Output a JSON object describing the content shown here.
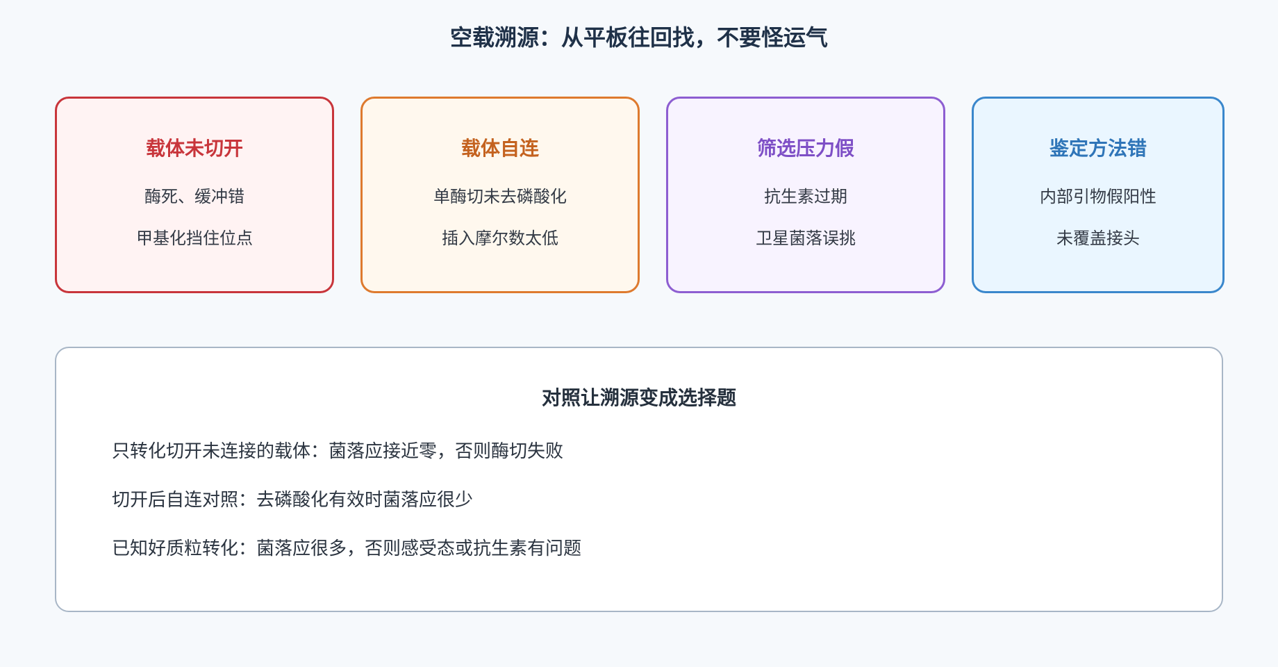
{
  "title": "空载溯源：从平板往回找，不要怪运气",
  "cards": [
    {
      "title": "载体未切开",
      "items": [
        "酶死、缓冲错",
        "甲基化挡住位点"
      ],
      "title_color": "#c8353b"
    },
    {
      "title": "载体自连",
      "items": [
        "单酶切未去磷酸化",
        "插入摩尔数太低"
      ],
      "title_color": "#c4621f"
    },
    {
      "title": "筛选压力假",
      "items": [
        "抗生素过期",
        "卫星菌落误挑"
      ],
      "title_color": "#7e4fc6"
    },
    {
      "title": "鉴定方法错",
      "items": [
        "内部引物假阳性",
        "未覆盖接头"
      ],
      "title_color": "#2f75b8"
    }
  ],
  "panel": {
    "title": "对照让溯源变成选择题",
    "lines": [
      "只转化切开未连接的载体：菌落应接近零，否则酶切失败",
      "切开后自连对照：去磷酸化有效时菌落应很少",
      "已知好质粒转化：菌落应很多，否则感受态或抗生素有问题"
    ]
  }
}
